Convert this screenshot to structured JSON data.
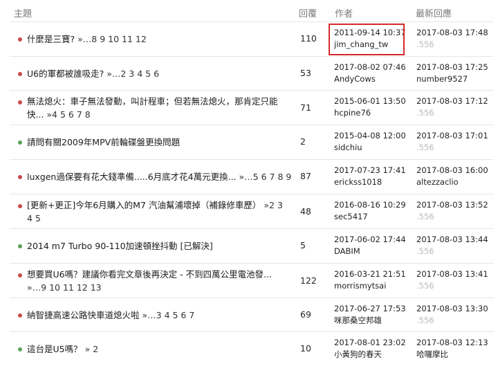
{
  "header": {
    "topic": "主題",
    "replies": "回覆",
    "author": "作者",
    "latest": "最新回應"
  },
  "rows": [
    {
      "title": "什麼是三寶?",
      "pages": " »…8 9 10 11 12",
      "replies": "110",
      "author_date": "2011-09-14 10:37",
      "author_name": "jim_chang_tw",
      "latest_date": "2017-08-03 17:48",
      "latest_user": "  .556",
      "dot": "red"
    },
    {
      "title": "U6的軍都被誰吸走?",
      "pages": " »…2 3 4 5 6",
      "replies": "53",
      "author_date": "2017-08-02 07:46",
      "author_name": "AndyCows",
      "latest_date": "2017-08-03 17:25",
      "latest_user": "number9527",
      "dot": "red"
    },
    {
      "title": "無法熄火：車子無法發動，叫計程車；但若無法熄火，那肯定只能快...",
      "pages": " »4 5 6 7 8",
      "replies": "71",
      "author_date": "2015-06-01 13:50",
      "author_name": "hcpine76",
      "latest_date": "2017-08-03 17:12",
      "latest_user": "  .556",
      "dot": "red"
    },
    {
      "title": "請問有關2009年MPV前輪碟盤更換問題",
      "pages": "",
      "replies": "2",
      "author_date": "2015-04-08 12:00",
      "author_name": "sidchiu",
      "latest_date": "2017-08-03 17:01",
      "latest_user": "  .556",
      "dot": "green"
    },
    {
      "title": "luxgen過保要有花大錢準備.....6月底才花4萬元更換...",
      "pages": " »…5 6 7 8 9",
      "replies": "87",
      "author_date": "2017-07-23 17:41",
      "author_name": "erickss1018",
      "latest_date": "2017-08-03 16:00",
      "latest_user": "altezzaclio",
      "dot": "red"
    },
    {
      "title": "[更新+更正]今年6月購入的M7 汽油幫浦壞掉（補錄修車歷）",
      "pages": " »2 3 4 5",
      "replies": "48",
      "author_date": "2016-08-16 10:29",
      "author_name": "sec5417",
      "latest_date": "2017-08-03 13:52",
      "latest_user": "  .556",
      "dot": "red"
    },
    {
      "title": "2014 m7 Turbo 90-110加速頓挫抖動 [已解決]",
      "pages": "",
      "replies": "5",
      "author_date": "2017-06-02 17:44",
      "author_name": "DABIM",
      "latest_date": "2017-08-03 13:44",
      "latest_user": "  .556",
      "dot": "green"
    },
    {
      "title": "想要買U6嗎？建議你看完文章後再決定 - 不到四萬公里電池發...",
      "pages": " »…9 10 11 12 13",
      "replies": "122",
      "author_date": "2016-03-21 21:51",
      "author_name": "morrismytsai",
      "latest_date": "2017-08-03 13:41",
      "latest_user": "  .556",
      "dot": "red"
    },
    {
      "title": "納智捷高速公路快車道熄火啦",
      "pages": " »…3 4 5 6 7",
      "replies": "69",
      "author_date": "2017-06-27 17:53",
      "author_name": "咪那桑空邦雄",
      "latest_date": "2017-08-03 13:30",
      "latest_user": "  .556",
      "dot": "red"
    },
    {
      "title": "這台是U5嗎？",
      "pages": " » 2",
      "replies": "10",
      "author_date": "2017-08-01 23:02",
      "author_name": "小黃狗的春天",
      "latest_date": "2017-08-03 12:13",
      "latest_user": "哈囉摩比",
      "dot": "green"
    }
  ],
  "colors": {
    "dot_red": "#c94a4a",
    "dot_green": "#5aa35a",
    "highlight": "#d42a2a"
  }
}
